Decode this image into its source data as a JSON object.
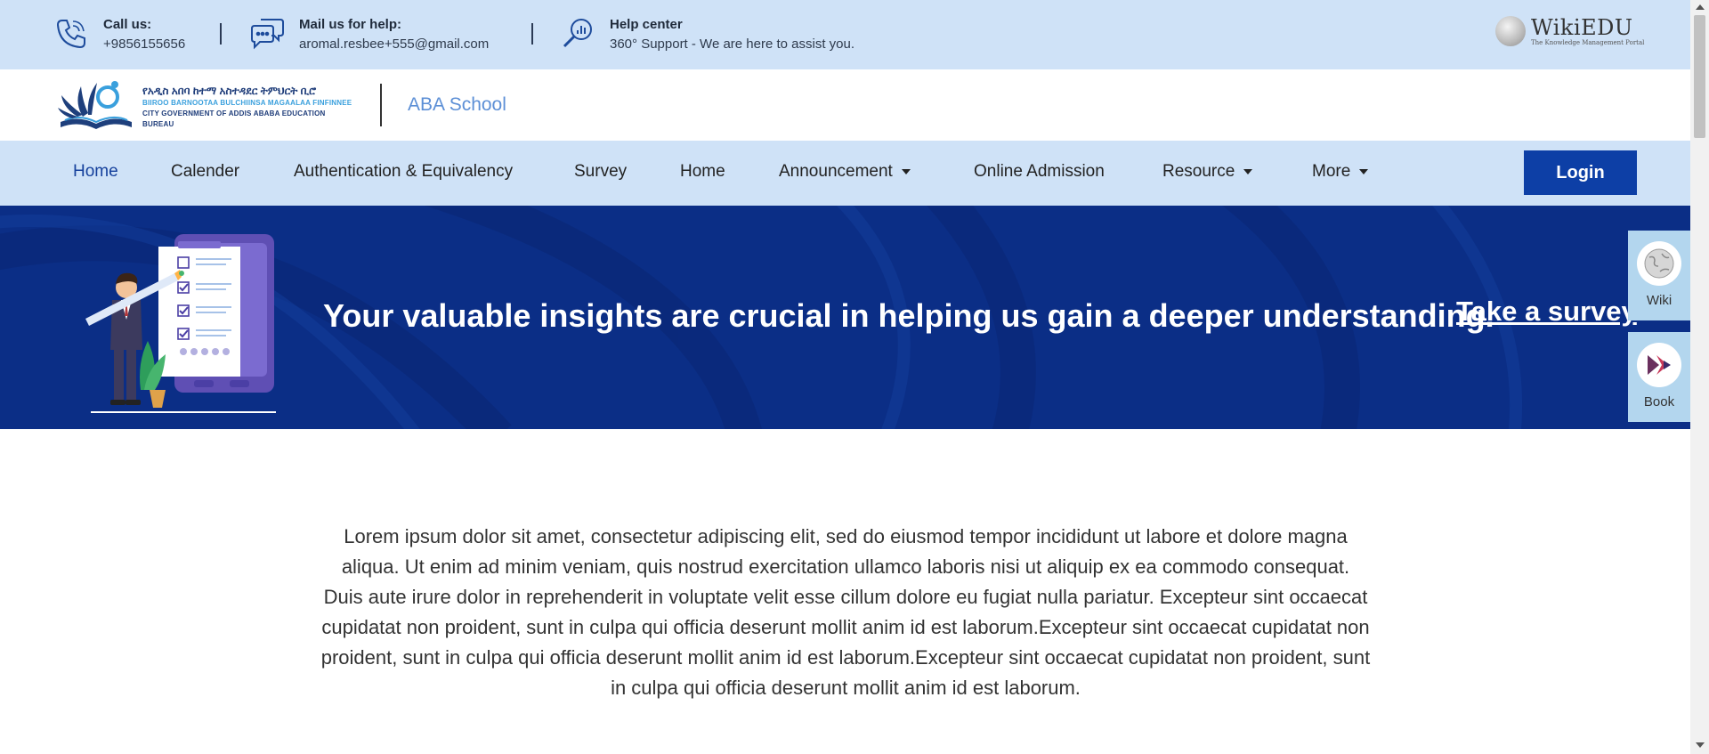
{
  "topbar": {
    "call": {
      "title": "Call us:",
      "value": "+9856155656",
      "icon": "phone-icon"
    },
    "mail": {
      "title": "Mail us for help:",
      "value": "aromal.resbee+555@gmail.com",
      "icon": "chat-bubbles-icon"
    },
    "help": {
      "title": "Help center",
      "value": "360° Support - We are here to assist you.",
      "icon": "magnifier-chart-icon"
    },
    "partner_logo": {
      "name": "WikiEDU",
      "tagline": "The Knowledge Management Portal"
    }
  },
  "logobar": {
    "logo_amharic": "የአዲስ አበባ ከተማ አስተዳደር ትምህርት ቢሮ",
    "logo_oromo": "BIIROO BARNOOTAA BULCHIINSA MAGAALAA FINFINNEE",
    "logo_english": "CITY GOVERNMENT OF ADDIS ABABA EDUCATION BUREAU",
    "school_name": "ABA School"
  },
  "nav": {
    "items": [
      {
        "label": "Home",
        "active": true
      },
      {
        "label": "Calender"
      },
      {
        "label": "Authentication & Equivalency"
      },
      {
        "label": "Survey"
      },
      {
        "label": "Home"
      },
      {
        "label": "Announcement",
        "dropdown": true
      },
      {
        "label": "Online Admission"
      },
      {
        "label": "Resource",
        "dropdown": true
      },
      {
        "label": "More",
        "dropdown": true
      }
    ],
    "login_label": "Login"
  },
  "banner": {
    "text": "Your valuable insights are crucial in helping us gain a deeper understanding.",
    "link": "Take a survey"
  },
  "side_widgets": [
    {
      "label": "Wiki",
      "icon": "globe-icon"
    },
    {
      "label": "Book",
      "icon": "book-logo-icon"
    }
  ],
  "content": {
    "paragraph": "Lorem ipsum dolor sit amet, consectetur adipiscing elit, sed do eiusmod tempor incididunt ut labore et dolore magna aliqua. Ut enim ad minim veniam, quis nostrud exercitation ullamco laboris nisi ut aliquip ex ea commodo consequat. Duis aute irure dolor in reprehenderit in voluptate velit esse cillum dolore eu fugiat nulla pariatur. Excepteur sint occaecat cupidatat non proident, sunt in culpa qui officia deserunt mollit anim id est laborum.Excepteur sint occaecat cupidatat non proident, sunt in culpa qui officia deserunt mollit anim id est laborum.Excepteur sint occaecat cupidatat non proident, sunt in culpa qui officia deserunt mollit anim id est laborum."
  },
  "colors": {
    "topbar_bg": "#cfe2f7",
    "banner_bg": "#0b2e86",
    "login_bg": "#0d3fa6",
    "active_nav": "#15409c",
    "school_name": "#5c8fd6"
  }
}
